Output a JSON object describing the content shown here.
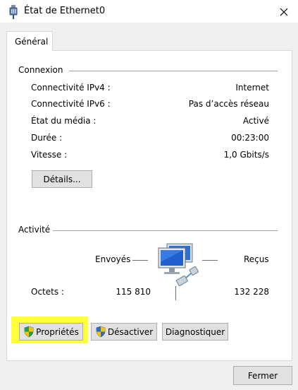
{
  "window": {
    "title": "État de Ethernet0",
    "icons": {
      "title": "network-adapter-icon",
      "close": "close-icon"
    }
  },
  "tabs": [
    {
      "label": "Général",
      "selected": true
    }
  ],
  "connexion": {
    "legend": "Connexion",
    "rows": [
      {
        "label": "Connectivité IPv4 :",
        "value": "Internet"
      },
      {
        "label": "Connectivité IPv6 :",
        "value": "Pas d’accès réseau"
      },
      {
        "label": "État du média :",
        "value": "Activé"
      },
      {
        "label": "Durée :",
        "value": "00:23:00"
      },
      {
        "label": "Vitesse :",
        "value": "1,0 Gbits/s"
      }
    ],
    "details_button": "Détails..."
  },
  "activite": {
    "legend": "Activité",
    "sent_label": "Envoyés",
    "received_label": "Reçus",
    "bytes_label": "Octets :",
    "bytes_sent": "115 810",
    "bytes_received": "132 228",
    "icon": "network-computers-icon"
  },
  "buttons": {
    "proprietes": "Propriétés",
    "desactiver": "Désactiver",
    "diagnostiquer": "Diagnostiquer",
    "fermer": "Fermer"
  },
  "colors": {
    "highlight": "#ffff3a",
    "shield_green": "#2e9b3a",
    "shield_blue": "#2c6bc9",
    "shield_yellow": "#f5c400"
  }
}
